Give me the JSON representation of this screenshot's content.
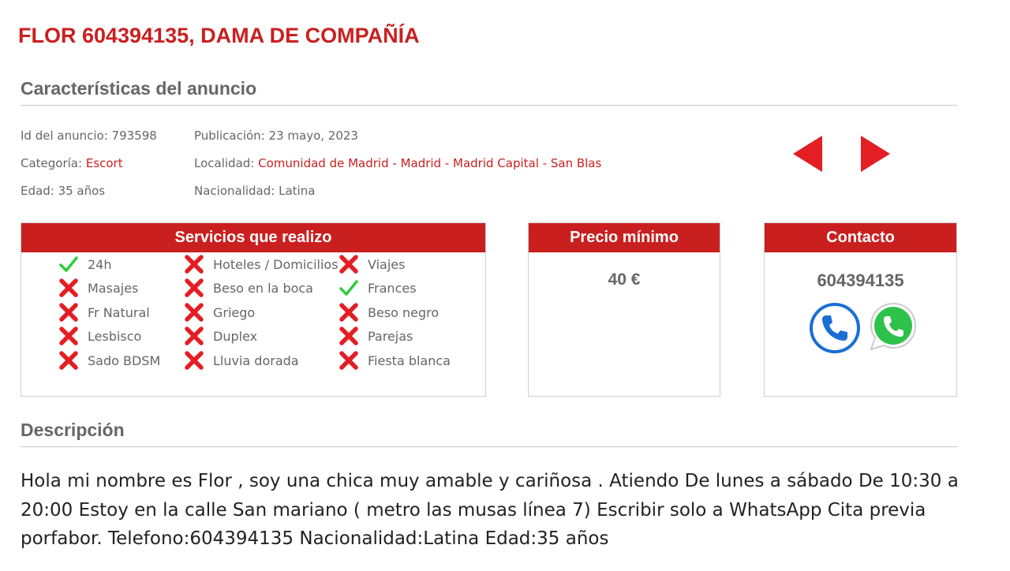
{
  "title": "FLOR 604394135, DAMA DE COMPAÑÍA",
  "features": {
    "heading": "Características del anuncio",
    "id_label": "Id del anuncio:",
    "id_value": "793598",
    "pub_label": "Publicación:",
    "pub_value": "23 mayo, 2023",
    "cat_label": "Categoría:",
    "cat_value": "Escort",
    "loc_label": "Localidad:",
    "loc_parts": [
      "Comunidad de Madrid",
      "Madrid",
      "Madrid Capital",
      "San Blas"
    ],
    "loc_sep": " - ",
    "age_label": "Edad:",
    "age_value": "35 años",
    "nat_label": "Nacionalidad:",
    "nat_value": "Latina"
  },
  "services": {
    "heading": "Servicios que realizo",
    "columns": [
      [
        {
          "label": "24h",
          "available": true
        },
        {
          "label": "Masajes",
          "available": false
        },
        {
          "label": "Fr Natural",
          "available": false
        },
        {
          "label": "Lesbisco",
          "available": false
        },
        {
          "label": "Sado BDSM",
          "available": false
        }
      ],
      [
        {
          "label": "Hoteles / Domicilios",
          "available": false
        },
        {
          "label": "Beso en la boca",
          "available": false
        },
        {
          "label": "Griego",
          "available": false
        },
        {
          "label": "Duplex",
          "available": false
        },
        {
          "label": "Lluvia dorada",
          "available": false
        }
      ],
      [
        {
          "label": "Viajes",
          "available": false
        },
        {
          "label": "Frances",
          "available": true
        },
        {
          "label": "Beso negro",
          "available": false
        },
        {
          "label": "Parejas",
          "available": false
        },
        {
          "label": "Fiesta blanca",
          "available": false
        }
      ]
    ]
  },
  "price": {
    "heading": "Precio mínimo",
    "value": "40 €"
  },
  "contact": {
    "heading": "Contacto",
    "phone": "604394135"
  },
  "description": {
    "heading": "Descripción",
    "text": "Hola mi nombre es Flor , soy una chica muy amable y cariñosa . Atiendo De lunes a sábado  De 10:30 a 20:00  Estoy en la calle San mariano ( metro las musas línea 7) Escribir solo a WhatsApp  Cita previa porfabor.   Telefono:604394135 Nacionalidad:Latina Edad:35 años"
  },
  "colors": {
    "accent_red": "#c9201f",
    "check_green": "#2ecc40",
    "cross_red": "#e31e24"
  }
}
